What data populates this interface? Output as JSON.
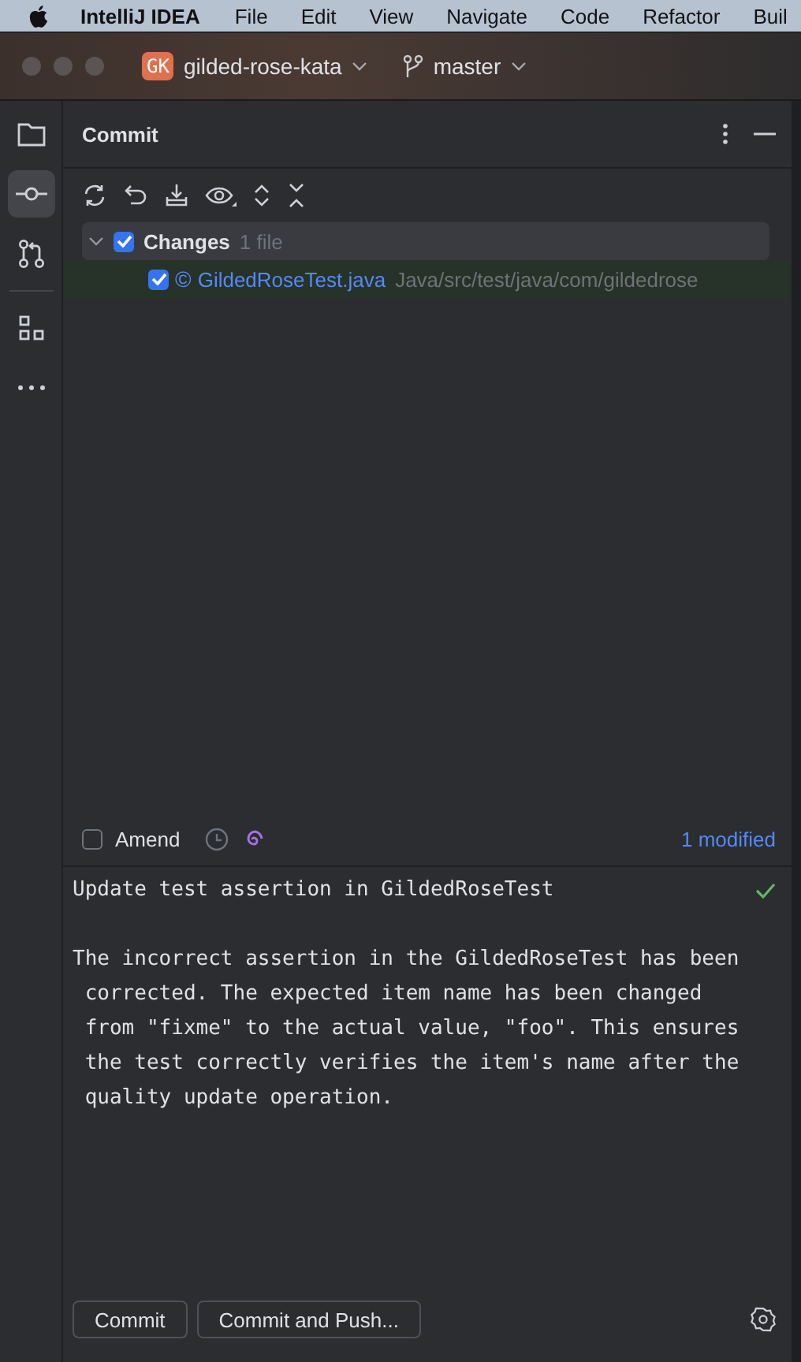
{
  "menu_bar": {
    "app_name": "IntelliJ IDEA",
    "items": [
      "File",
      "Edit",
      "View",
      "Navigate",
      "Code",
      "Refactor",
      "Buil"
    ]
  },
  "title_bar": {
    "project_badge": "GK",
    "project": "gilded-rose-kata",
    "branch": "master"
  },
  "tool_strip": {
    "items": [
      {
        "kind": "folder",
        "selected": false
      },
      {
        "kind": "commit",
        "selected": true
      },
      {
        "kind": "pull-request",
        "selected": false
      },
      {
        "kind": "structure",
        "selected": false
      },
      {
        "kind": "more",
        "selected": false
      }
    ]
  },
  "panel": {
    "title": "Commit"
  },
  "tree": {
    "group": {
      "label": "Changes",
      "count": "1 file",
      "checked": true,
      "expanded": true,
      "children": [
        {
          "icon_letter": "©",
          "name": "GildedRoseTest.java",
          "path": "Java/src/test/java/com/gildedrose",
          "checked": true
        }
      ]
    }
  },
  "amend": {
    "label": "Amend",
    "checked": false,
    "summary": "1 modified"
  },
  "message": {
    "subject": "Update test assertion in GildedRoseTest",
    "body": "The incorrect assertion in the GildedRoseTest has been\n corrected. The expected item name has been changed\n from \"fixme\" to the actual value, \"foo\". This ensures\n the test correctly verifies the item's name after the\n quality update operation.",
    "valid": true
  },
  "buttons": [
    "Commit",
    "Commit and Push..."
  ]
}
